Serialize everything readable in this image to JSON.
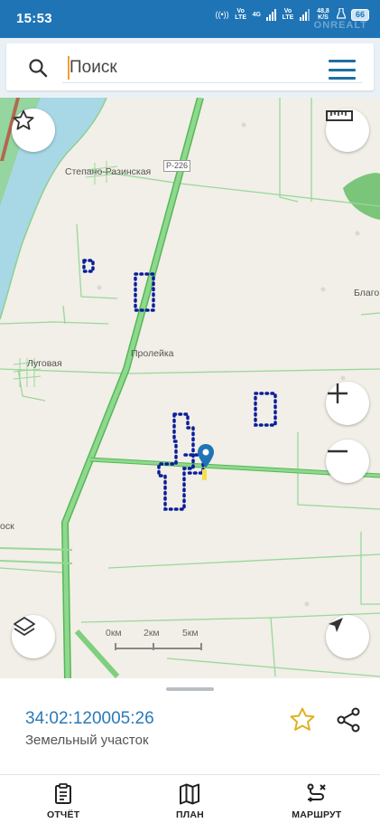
{
  "status_bar": {
    "time": "15:53",
    "hotspot": "((•))",
    "vo_lte_1": "Vo LTE",
    "network_type": "4G",
    "vo_lte_2": "Vo LTE",
    "data_speed": "48,8 K/S",
    "battery": "66",
    "watermark": "ONREALT"
  },
  "search": {
    "placeholder": "Поиск"
  },
  "map": {
    "labels": {
      "stepano_razinskaya": "Степано-Разинская",
      "road_r226": "Р-226",
      "blago": "Благо",
      "proleyka": "Пролейка",
      "lugovaya": "Луговая",
      "rosk": "оск"
    },
    "scale": {
      "l0": "0км",
      "l2": "2км",
      "l5": "5км"
    },
    "colors": {
      "water": "#a8d8e6",
      "land": "#f1efe7",
      "highway": "#7fcf7f",
      "roads": "#8fd08f",
      "parcels": "#0a1e9a",
      "marker": "#1f74b6"
    }
  },
  "sheet": {
    "parcel_id": "34:02:120005:26",
    "parcel_type": "Земельный участок"
  },
  "nav": {
    "report": "ОТЧЁТ",
    "plan": "ПЛАН",
    "route": "МАРШРУТ"
  }
}
